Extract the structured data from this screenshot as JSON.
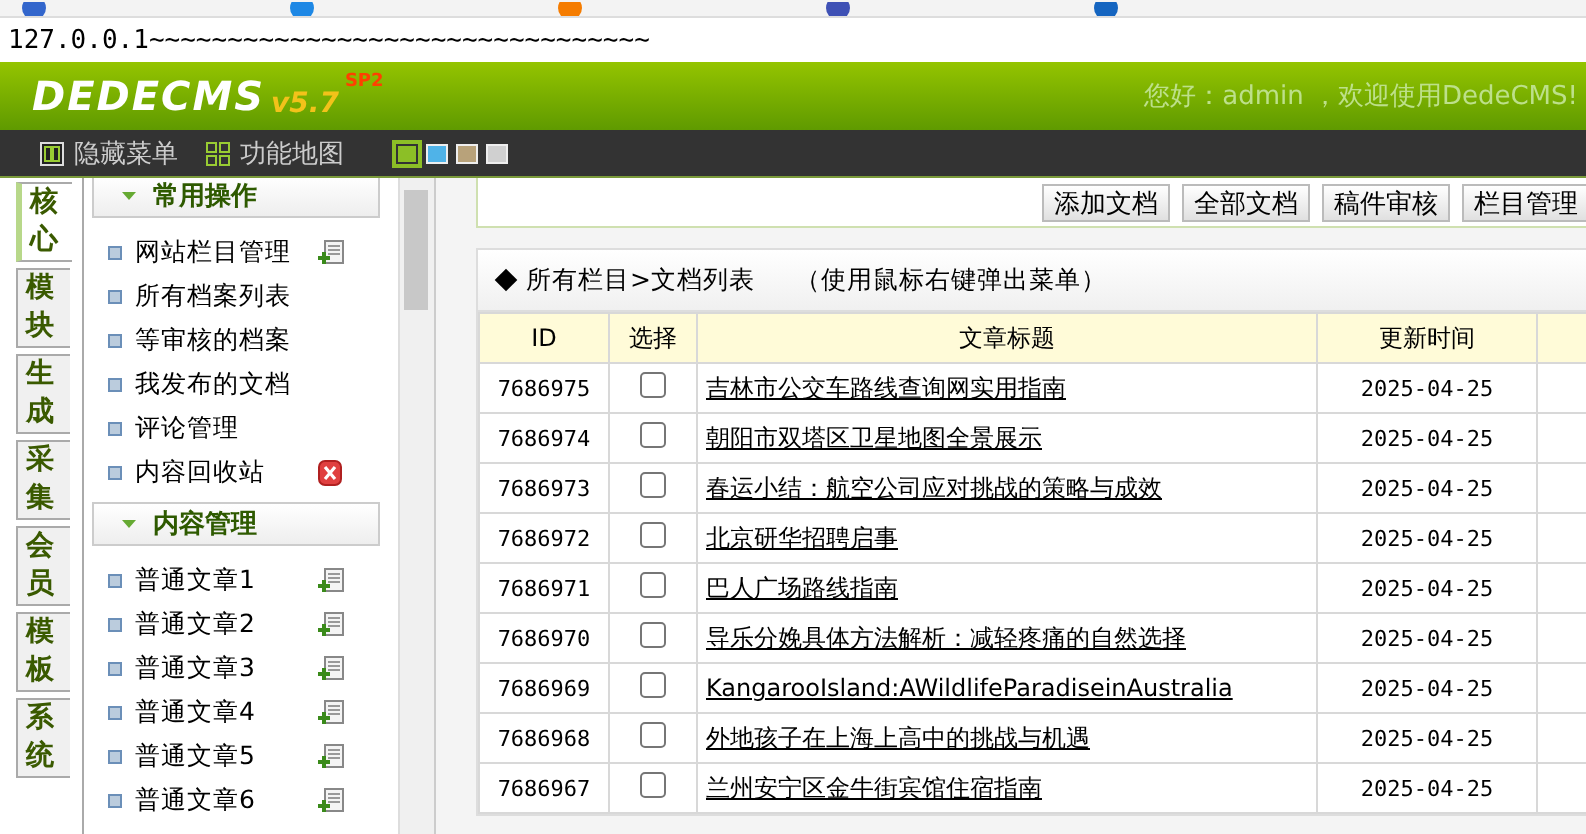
{
  "address_bar": {
    "value": "127.0.0.1~~~~~~~~~~~~~~~~~~~~~~~~~~~~~~~~"
  },
  "header": {
    "logo": "DEDECMS",
    "version": "v5.7",
    "edition": "SP2",
    "welcome": "您好：admin ，欢迎使用DedeCMS!"
  },
  "menu_bar": {
    "items": [
      {
        "label": "隐藏菜单",
        "kind": "columns"
      },
      {
        "label": "功能地图",
        "kind": "grid"
      }
    ],
    "skins": [
      {
        "color": "#8cbf26",
        "selected": true
      },
      {
        "color": "#4fb3e8",
        "selected": false
      },
      {
        "color": "#b8a27a",
        "selected": false
      },
      {
        "color": "#d0d0d0",
        "selected": false
      }
    ]
  },
  "side_tabs": [
    {
      "label": "核心",
      "selected": true
    },
    {
      "label": "模块",
      "selected": false
    },
    {
      "label": "生成",
      "selected": false
    },
    {
      "label": "采集",
      "selected": false
    },
    {
      "label": "会员",
      "selected": false
    },
    {
      "label": "模板",
      "selected": false
    },
    {
      "label": "系统",
      "selected": false
    }
  ],
  "menu_sections": [
    {
      "title": "常用操作",
      "expanded": true,
      "items": [
        {
          "label": "网站栏目管理",
          "kind": "add"
        },
        {
          "label": "所有档案列表",
          "kind": "plain"
        },
        {
          "label": "等审核的档案",
          "kind": "plain"
        },
        {
          "label": "我发布的文档",
          "kind": "plain"
        },
        {
          "label": "评论管理",
          "kind": "plain"
        },
        {
          "label": "内容回收站",
          "kind": "delete"
        }
      ]
    },
    {
      "title": "内容管理",
      "expanded": true,
      "items": [
        {
          "label": "普通文章1",
          "kind": "add"
        },
        {
          "label": "普通文章2",
          "kind": "add"
        },
        {
          "label": "普通文章3",
          "kind": "add"
        },
        {
          "label": "普通文章4",
          "kind": "add"
        },
        {
          "label": "普通文章5",
          "kind": "add"
        },
        {
          "label": "普通文章6",
          "kind": "add"
        }
      ]
    }
  ],
  "toolbar": {
    "buttons": [
      "添加文档",
      "全部文档",
      "稿件审核",
      "栏目管理"
    ]
  },
  "list": {
    "title": "所有栏目>文档列表",
    "hint": "（使用鼠标右键弹出菜单）",
    "columns": [
      "ID",
      "选择",
      "文章标题",
      "更新时间"
    ],
    "rows": [
      {
        "id": "7686975",
        "selected": false,
        "title": "吉林市公交车路线查询网实用指南",
        "date": "2025-04-25"
      },
      {
        "id": "7686974",
        "selected": false,
        "title": "朝阳市双塔区卫星地图全景展示",
        "date": "2025-04-25"
      },
      {
        "id": "7686973",
        "selected": false,
        "title": "春运小结：航空公司应对挑战的策略与成效",
        "date": "2025-04-25"
      },
      {
        "id": "7686972",
        "selected": false,
        "title": "北京研华招聘启事",
        "date": "2025-04-25"
      },
      {
        "id": "7686971",
        "selected": false,
        "title": "巴人广场路线指南",
        "date": "2025-04-25"
      },
      {
        "id": "7686970",
        "selected": false,
        "title": "导乐分娩具体方法解析：减轻疼痛的自然选择",
        "date": "2025-04-25"
      },
      {
        "id": "7686969",
        "selected": false,
        "title": "KangarooIsland:AWildlifeParadiseinAustralia",
        "date": "2025-04-25"
      },
      {
        "id": "7686968",
        "selected": false,
        "title": "外地孩子在上海上高中的挑战与机遇",
        "date": "2025-04-25"
      },
      {
        "id": "7686967",
        "selected": false,
        "title": "兰州安宁区金牛街宾馆住宿指南",
        "date": "2025-04-25"
      }
    ]
  }
}
